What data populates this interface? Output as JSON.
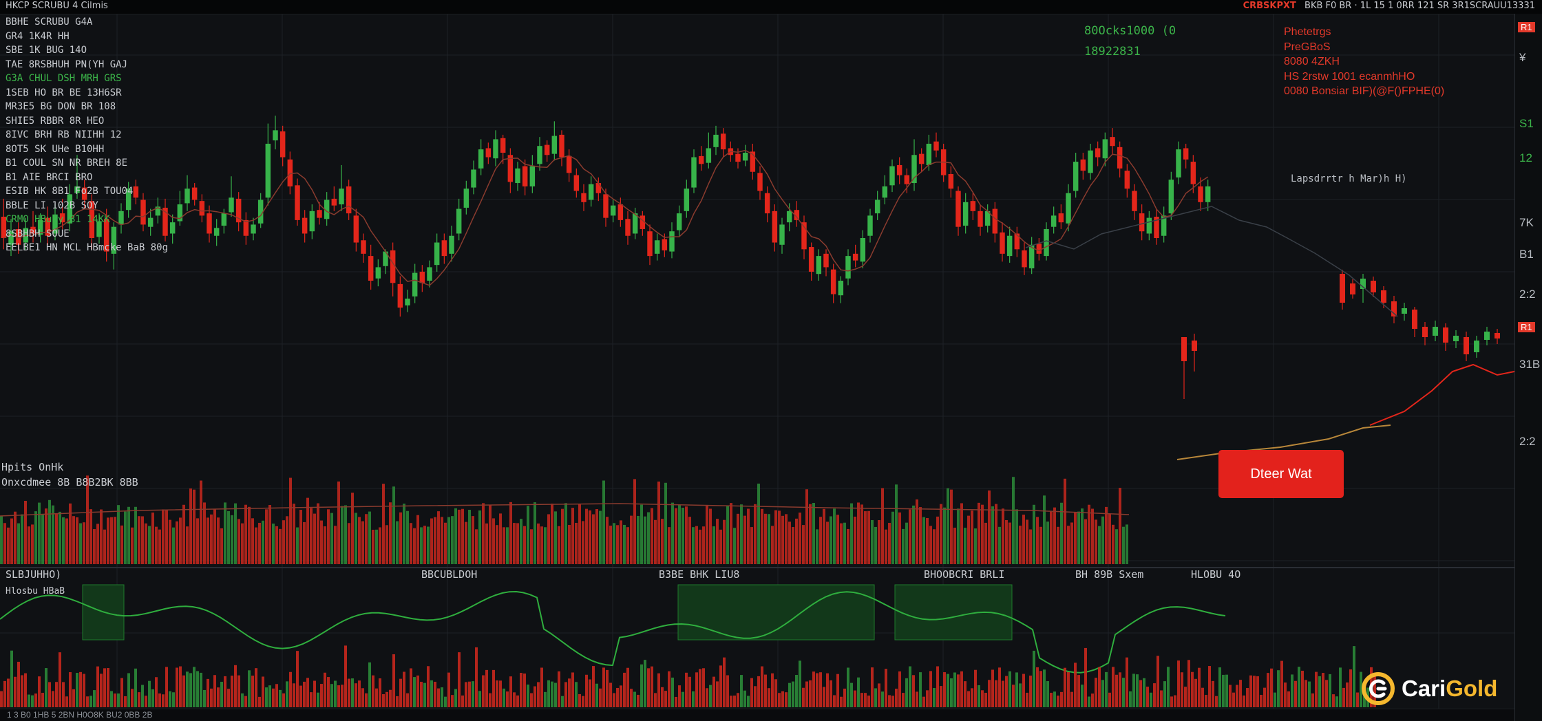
{
  "topbar": {
    "left_title": "HKCP SCRUBU 4  Cilmis",
    "symbol": "CRBSKPXT",
    "right_ticker": "BKB F0 BR · 1L 15 1 0RR 121 SR 3R1SCRAUU13331"
  },
  "info_lines": [
    {
      "text": "BBHE SCRUBU G4A",
      "color": "#c9ccd1"
    },
    {
      "text": "GR4 1K4R HH",
      "color": "#c9ccd1"
    },
    {
      "text": "SBE 1K BUG 14O",
      "color": "#c9ccd1"
    },
    {
      "text": "TAE 8RSBHUH PN(YH GAJ",
      "color": "#c9ccd1"
    },
    {
      "text": "G3A CHUL DSH MRH GRS",
      "color": "#3cb54a"
    },
    {
      "text": "1SEB HO BR BE 13H6SR",
      "color": "#c9ccd1"
    },
    {
      "text": "MR3E5 BG DON BR 108",
      "color": "#c9ccd1"
    },
    {
      "text": "SHIE5 RBBR 8R HEO",
      "color": "#c9ccd1"
    },
    {
      "text": "8IVC BRH RB NIIHH 12",
      "color": "#c9ccd1"
    },
    {
      "text": "8OT5 SK UHe B10HH",
      "color": "#c9ccd1"
    },
    {
      "text": "B1 COUL SN NR BREH 8E",
      "color": "#c9ccd1"
    },
    {
      "text": "B1 AIE BRCI BRO",
      "color": "#c9ccd1"
    },
    {
      "text": "ESIB HK 8B1 Fo2B TOU04",
      "color": "#c9ccd1"
    },
    {
      "text": "BBLE LI 102B SOY",
      "color": "#c9ccd1"
    },
    {
      "text": "CRMO HBuky B1 14KK",
      "color": "#3cb54a"
    },
    {
      "text": "8SBHBH SOUE",
      "color": "#c9ccd1"
    },
    {
      "text": "EELBE1 HN MCL HBmcke BaB 80g",
      "color": "#c9ccd1"
    }
  ],
  "price_readout": {
    "line1": "80Ocks1000 (0",
    "line2": "18922831"
  },
  "stats": [
    "Phetetrgs",
    "PreGBoS",
    "8080 4ZKH",
    "HS 2rstw 1001 ecanmhHO",
    "0080 Bonsiar BIF)(@F()FPHE(0)"
  ],
  "annotation": "Lapsdrrtr h Mar)h H)",
  "volume_pane_label": [
    "Hpits OnHk",
    "Onxcdmee 8B B8B2BK 8BB"
  ],
  "indicator_pane_labels": [
    "SLBJUHHO)",
    "BBCUBLDOH",
    "B3BE BHK LIU8",
    "BHOOBCRI BRLI",
    "BH 89B Sxem",
    "HLOBU 4O"
  ],
  "indicator_sub_label": "Hlosbu HBaB",
  "order_button_label": "Dteer Wat",
  "right_axis": [
    {
      "text": "R1",
      "tag": true
    },
    {
      "text": "¥",
      "tag": false
    },
    {
      "text": "S1",
      "tag": false
    },
    {
      "text": "12",
      "tag": false
    },
    {
      "text": "7K",
      "tag": false
    },
    {
      "text": "B1",
      "tag": false
    },
    {
      "text": "2:2",
      "tag": false
    },
    {
      "text": "R1",
      "tag": true
    },
    {
      "text": "31B",
      "tag": false
    },
    {
      "text": "2:2",
      "tag": false
    }
  ],
  "logo": {
    "part1": "Cari",
    "part2": "Gold"
  },
  "bottom_strip": "1 3  B0 1HB  5 2BN  H0O8K  BU2  0BB  2B",
  "colors": {
    "up": "#37b34a",
    "down": "#e3261b",
    "background": "#0f1114",
    "grid": "#1d2126",
    "accent_gold": "#f5b82e"
  },
  "chart_data": {
    "type": "candlestick",
    "series": [
      {
        "name": "",
        "values": [
          [
            335,
            316,
            351,
            306
          ],
          [
            310,
            322,
            333,
            300
          ],
          [
            324,
            310,
            330,
            302
          ],
          [
            312,
            325,
            334,
            305
          ],
          [
            326,
            320,
            340,
            312
          ],
          [
            319,
            332,
            338,
            312
          ],
          [
            334,
            318,
            344,
            310
          ],
          [
            320,
            337,
            346,
            314
          ],
          [
            338,
            330,
            351,
            324
          ],
          [
            329,
            355,
            364,
            322
          ],
          [
            356,
            362,
            390,
            351
          ],
          [
            361,
            350,
            368,
            342
          ],
          [
            349,
            316,
            355,
            306
          ],
          [
            317,
            331,
            338,
            311
          ],
          [
            333,
            304,
            342,
            295
          ],
          [
            302,
            326,
            330,
            288
          ],
          [
            328,
            340,
            347,
            320
          ],
          [
            341,
            360,
            366,
            334
          ],
          [
            362,
            352,
            368,
            346
          ],
          [
            350,
            328,
            356,
            322
          ],
          [
            326,
            334,
            342,
            318
          ],
          [
            336,
            344,
            352,
            329
          ],
          [
            343,
            318,
            351,
            313
          ],
          [
            320,
            330,
            337,
            311
          ],
          [
            331,
            346,
            358,
            327
          ],
          [
            347,
            360,
            372,
            340
          ],
          [
            361,
            350,
            365,
            345
          ],
          [
            349,
            336,
            355,
            330
          ],
          [
            338,
            320,
            345,
            312
          ],
          [
            318,
            325,
            333,
            309
          ],
          [
            327,
            338,
            342,
            320
          ],
          [
            339,
            352,
            371,
            335
          ],
          [
            351,
            330,
            357,
            322
          ],
          [
            332,
            318,
            339,
            310
          ],
          [
            320,
            328,
            334,
            314
          ],
          [
            329,
            350,
            356,
            325
          ],
          [
            352,
            400,
            418,
            345
          ],
          [
            403,
            412,
            425,
            395
          ],
          [
            411,
            388,
            416,
            380
          ],
          [
            386,
            362,
            393,
            355
          ],
          [
            363,
            332,
            369,
            327
          ],
          [
            334,
            320,
            341,
            312
          ],
          [
            322,
            340,
            346,
            315
          ],
          [
            341,
            334,
            348,
            328
          ],
          [
            333,
            350,
            357,
            327
          ],
          [
            351,
            345,
            362,
            340
          ],
          [
            346,
            360,
            381,
            340
          ],
          [
            362,
            338,
            368,
            332
          ],
          [
            336,
            312,
            342,
            304
          ],
          [
            314,
            302,
            320,
            294
          ],
          [
            300,
            278,
            310,
            270
          ],
          [
            280,
            290,
            297,
            273
          ],
          [
            291,
            304,
            306,
            284
          ],
          [
            305,
            276,
            312,
            264
          ],
          [
            275,
            254,
            282,
            246
          ],
          [
            256,
            262,
            270,
            250
          ],
          [
            264,
            285,
            293,
            258
          ],
          [
            286,
            276,
            292,
            268
          ],
          [
            278,
            290,
            296,
            272
          ],
          [
            292,
            312,
            320,
            286
          ],
          [
            314,
            300,
            320,
            293
          ],
          [
            302,
            318,
            327,
            295
          ],
          [
            320,
            342,
            351,
            314
          ],
          [
            343,
            360,
            367,
            337
          ],
          [
            361,
            377,
            385,
            355
          ],
          [
            378,
            395,
            404,
            372
          ],
          [
            396,
            388,
            401,
            382
          ],
          [
            387,
            404,
            412,
            380
          ],
          [
            405,
            392,
            408,
            382
          ],
          [
            390,
            366,
            396,
            356
          ],
          [
            365,
            378,
            384,
            358
          ],
          [
            380,
            362,
            386,
            354
          ],
          [
            362,
            380,
            390,
            356
          ],
          [
            382,
            398,
            406,
            376
          ],
          [
            399,
            390,
            403,
            384
          ],
          [
            391,
            407,
            420,
            385
          ],
          [
            408,
            388,
            412,
            380
          ],
          [
            389,
            374,
            395,
            366
          ],
          [
            372,
            358,
            378,
            352
          ],
          [
            356,
            348,
            364,
            340
          ],
          [
            350,
            364,
            371,
            344
          ],
          [
            365,
            356,
            370,
            349
          ],
          [
            355,
            334,
            360,
            326
          ],
          [
            336,
            345,
            350,
            330
          ],
          [
            346,
            332,
            352,
            326
          ],
          [
            333,
            318,
            340,
            310
          ],
          [
            320,
            338,
            343,
            315
          ],
          [
            336,
            324,
            340,
            318
          ],
          [
            322,
            300,
            328,
            292
          ],
          [
            302,
            314,
            320,
            296
          ],
          [
            315,
            305,
            320,
            299
          ],
          [
            304,
            322,
            330,
            298
          ],
          [
            323,
            338,
            345,
            318
          ],
          [
            340,
            360,
            368,
            334
          ],
          [
            361,
            388,
            395,
            356
          ],
          [
            389,
            382,
            398,
            376
          ],
          [
            383,
            396,
            410,
            378
          ],
          [
            397,
            408,
            416,
            390
          ],
          [
            409,
            395,
            414,
            388
          ],
          [
            396,
            390,
            402,
            384
          ],
          [
            391,
            384,
            396,
            378
          ],
          [
            385,
            392,
            399,
            380
          ],
          [
            393,
            375,
            400,
            368
          ],
          [
            374,
            358,
            380,
            350
          ],
          [
            356,
            338,
            362,
            330
          ],
          [
            340,
            312,
            346,
            304
          ],
          [
            310,
            328,
            334,
            302
          ],
          [
            330,
            340,
            347,
            322
          ],
          [
            341,
            332,
            349,
            326
          ],
          [
            330,
            306,
            336,
            297
          ],
          [
            308,
            286,
            312,
            278
          ],
          [
            284,
            300,
            306,
            278
          ],
          [
            302,
            290,
            306,
            282
          ],
          [
            288,
            266,
            293,
            258
          ],
          [
            265,
            278,
            282,
            258
          ],
          [
            280,
            300,
            306,
            274
          ],
          [
            302,
            296,
            310,
            290
          ],
          [
            295,
            316,
            323,
            289
          ],
          [
            318,
            336,
            342,
            312
          ],
          [
            338,
            350,
            358,
            332
          ],
          [
            352,
            362,
            372,
            346
          ],
          [
            363,
            380,
            386,
            357
          ],
          [
            381,
            372,
            388,
            364
          ],
          [
            372,
            364,
            378,
            356
          ],
          [
            365,
            390,
            404,
            358
          ],
          [
            391,
            382,
            396,
            375
          ],
          [
            381,
            400,
            408,
            376
          ],
          [
            402,
            394,
            410,
            388
          ],
          [
            395,
            372,
            400,
            366
          ],
          [
            373,
            360,
            380,
            352
          ],
          [
            358,
            326,
            362,
            318
          ],
          [
            327,
            348,
            356,
            320
          ],
          [
            349,
            340,
            356,
            332
          ],
          [
            340,
            326,
            346,
            318
          ],
          [
            327,
            340,
            346,
            321
          ],
          [
            342,
            320,
            348,
            312
          ],
          [
            321,
            302,
            330,
            295
          ],
          [
            300,
            318,
            326,
            294
          ],
          [
            320,
            306,
            326,
            299
          ],
          [
            305,
            290,
            312,
            283
          ],
          [
            289,
            310,
            317,
            284
          ],
          [
            311,
            302,
            316,
            296
          ],
          [
            300,
            324,
            330,
            296
          ],
          [
            326,
            336,
            344,
            320
          ],
          [
            338,
            330,
            346,
            324
          ],
          [
            329,
            356,
            364,
            322
          ],
          [
            358,
            384,
            392,
            352
          ],
          [
            386,
            376,
            392,
            368
          ],
          [
            374,
            394,
            400,
            368
          ],
          [
            396,
            388,
            402,
            380
          ],
          [
            387,
            404,
            410,
            380
          ],
          [
            406,
            398,
            414,
            390
          ],
          [
            397,
            378,
            402,
            370
          ],
          [
            376,
            360,
            382,
            352
          ],
          [
            358,
            340,
            364,
            332
          ],
          [
            338,
            322,
            346,
            314
          ],
          [
            320,
            334,
            340,
            314
          ],
          [
            335,
            316,
            342,
            310
          ],
          [
            318,
            336,
            344,
            312
          ],
          [
            338,
            368,
            375,
            332
          ],
          [
            370,
            395,
            402,
            364
          ],
          [
            396,
            386,
            400,
            378
          ],
          [
            384,
            364,
            390,
            356
          ],
          [
            362,
            348,
            370,
            340
          ],
          [
            348,
            362,
            368,
            340
          ]
        ]
      }
    ],
    "ylim": [
      240,
      430
    ],
    "xlim": [
      0,
      160
    ],
    "grid": true
  }
}
